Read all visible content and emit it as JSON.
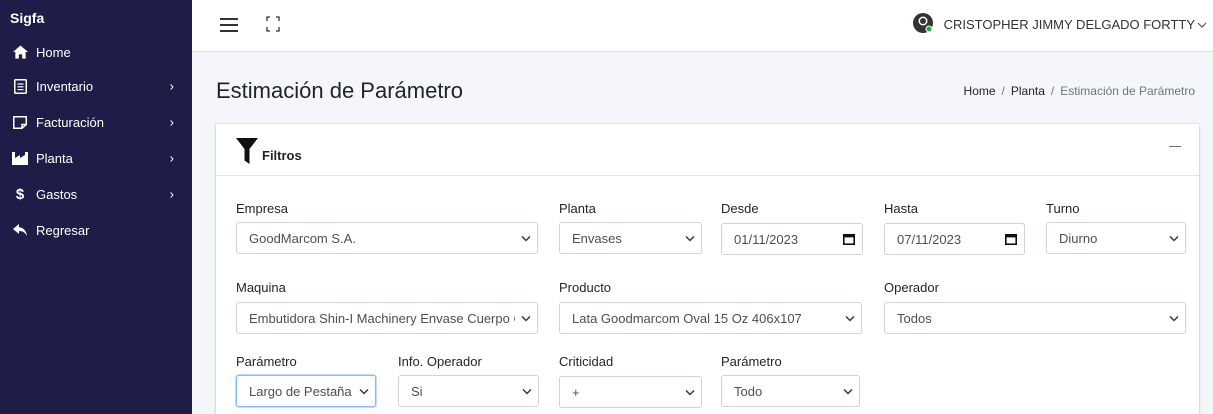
{
  "app": {
    "brand": "Sigfa"
  },
  "sidebar": {
    "items": [
      {
        "label": "Home",
        "icon": "home-icon",
        "has_submenu": false
      },
      {
        "label": "Inventario",
        "icon": "file-icon",
        "has_submenu": true
      },
      {
        "label": "Facturación",
        "icon": "invoice-icon",
        "has_submenu": true
      },
      {
        "label": "Planta",
        "icon": "factory-icon",
        "has_submenu": true
      },
      {
        "label": "Gastos",
        "icon": "dollar-icon",
        "has_submenu": true
      },
      {
        "label": "Regresar",
        "icon": "back-arrow-icon",
        "has_submenu": false
      }
    ]
  },
  "topbar": {
    "user_name": "CRISTOPHER JIMMY DELGADO FORTTY"
  },
  "page": {
    "title": "Estimación de Parámetro",
    "breadcrumb": [
      "Home",
      "Planta",
      "Estimación de Parámetro"
    ]
  },
  "filters": {
    "card_title": "Filtros",
    "empresa": {
      "label": "Empresa",
      "value": "GoodMarcom S.A."
    },
    "planta": {
      "label": "Planta",
      "value": "Envases"
    },
    "desde": {
      "label": "Desde",
      "value": "01/11/2023"
    },
    "hasta": {
      "label": "Hasta",
      "value": "07/11/2023"
    },
    "turno": {
      "label": "Turno",
      "value": "Diurno"
    },
    "maquina": {
      "label": "Maquina",
      "value": "Embutidora Shin-I Machinery Envase Cuerpo C"
    },
    "producto": {
      "label": "Producto",
      "value": "Lata Goodmarcom Oval 15 Oz 406x107"
    },
    "operador": {
      "label": "Operador",
      "value": "Todos"
    },
    "parametro": {
      "label": "Parámetro",
      "value": "Largo de Pestaña"
    },
    "info_operador": {
      "label": "Info. Operador",
      "value": "Si"
    },
    "criticidad": {
      "label": "Criticidad",
      "value": "+"
    },
    "parametro2": {
      "label": "Parámetro",
      "value": "Todo"
    }
  },
  "colors": {
    "sidebar_bg": "#1f1d48",
    "focus_border": "#80bdff"
  }
}
